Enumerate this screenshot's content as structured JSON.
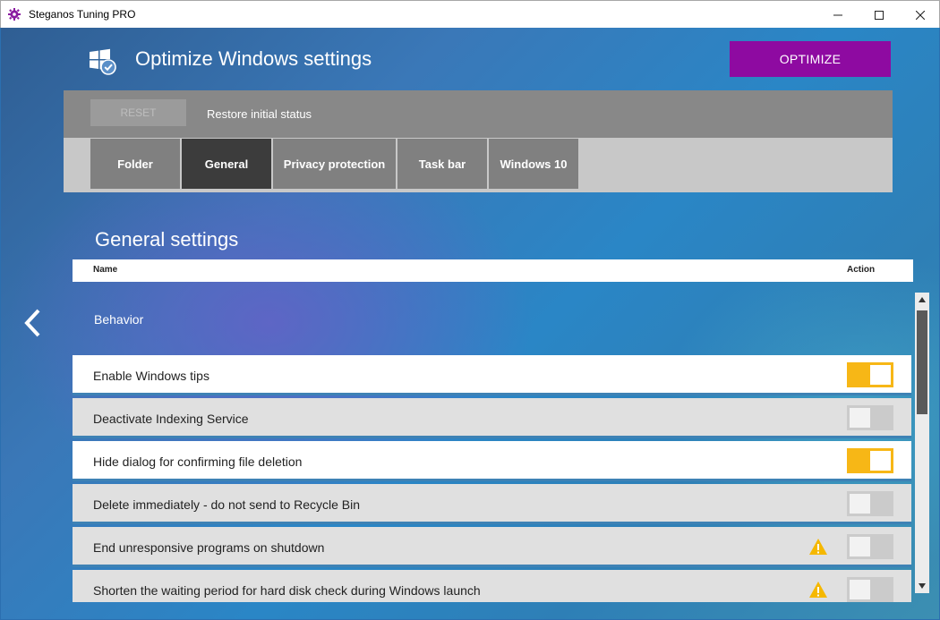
{
  "window": {
    "title": "Steganos Tuning PRO"
  },
  "header": {
    "title": "Optimize Windows settings",
    "optimize_label": "OPTIMIZE"
  },
  "reset_bar": {
    "reset_label": "RESET",
    "restore_label": "Restore initial status"
  },
  "tabs": [
    {
      "label": "Folder",
      "active": false
    },
    {
      "label": "General",
      "active": true
    },
    {
      "label": "Privacy protection",
      "active": false
    },
    {
      "label": "Task bar",
      "active": false
    },
    {
      "label": "Windows 10",
      "active": false
    }
  ],
  "section": {
    "title": "General settings"
  },
  "table": {
    "col_name": "Name",
    "col_action": "Action"
  },
  "group": {
    "label": "Behavior"
  },
  "settings": [
    {
      "label": "Enable Windows tips",
      "enabled": true,
      "warning": false
    },
    {
      "label": "Deactivate Indexing Service",
      "enabled": false,
      "warning": false
    },
    {
      "label": "Hide dialog for confirming file deletion",
      "enabled": true,
      "warning": false
    },
    {
      "label": "Delete immediately - do not send to Recycle Bin",
      "enabled": false,
      "warning": false
    },
    {
      "label": "End unresponsive programs on shutdown",
      "enabled": false,
      "warning": true
    },
    {
      "label": "Shorten the waiting period for hard disk check during Windows launch",
      "enabled": false,
      "warning": true
    }
  ],
  "colors": {
    "accent_purple": "#8e0aa1",
    "toggle_on": "#f7b716",
    "toggle_off": "#cbcbcb",
    "warning": "#f5b800"
  },
  "icons": {
    "app": "gear-icon",
    "header": "windows-check-icon",
    "back": "chevron-left-icon",
    "warning": "warning-icon"
  }
}
